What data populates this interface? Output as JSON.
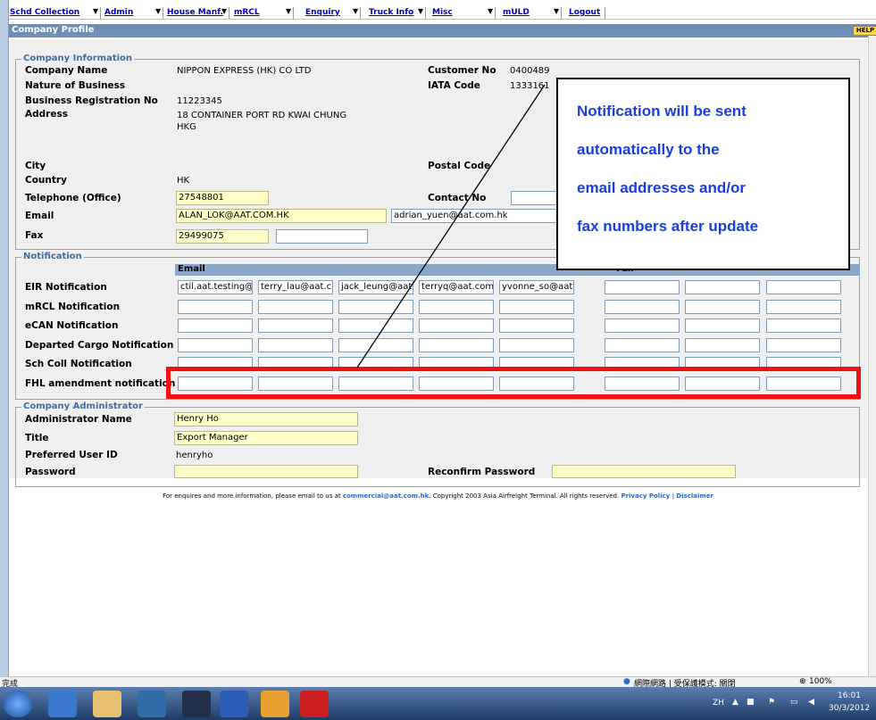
{
  "menu": {
    "items": [
      "Schd Collection",
      "Admin",
      "House Manf.",
      "mRCL",
      "Enquiry",
      "Truck Info",
      "Misc",
      "mULD",
      "Logout"
    ]
  },
  "page": {
    "title": "Company Profile",
    "help": "HELP"
  },
  "company_info": {
    "legend": "Company Information",
    "company_name_label": "Company Name",
    "company_name": "NIPPON EXPRESS (HK) CO LTD",
    "customer_no_label": "Customer No",
    "customer_no": "0400489",
    "nature_label": "Nature of Business",
    "iata_label": "IATA Code",
    "iata_code": "1333161",
    "brn_label": "Business Registration No",
    "brn": "11223345",
    "address_label": "Address",
    "address_line1": "18 CONTAINER PORT RD KWAI CHUNG",
    "address_line2": "HKG",
    "city_label": "City",
    "postal_label": "Postal Code",
    "country_label": "Country",
    "country": "HK",
    "telephone_label": "Telephone (Office)",
    "telephone": "27548801",
    "contact_label": "Contact No",
    "email_label": "Email",
    "email1": "ALAN_LOK@AAT.COM.HK",
    "email2": "adrian_yuen@aat.com.hk",
    "fax_label": "Fax",
    "fax": "29499075"
  },
  "notification": {
    "legend": "Notification",
    "email_header": "Email",
    "fax_header": "Fax",
    "rows": [
      {
        "label": "EIR Notification",
        "emails": [
          "ctil.aat.testing@",
          "terry_lau@aat.c",
          "jack_leung@aat",
          "terryq@aat.com",
          "yvonne_so@aat"
        ]
      },
      {
        "label": "mRCL Notification",
        "emails": [
          "",
          "",
          "",
          "",
          ""
        ]
      },
      {
        "label": "eCAN Notification",
        "emails": [
          "",
          "",
          "",
          "",
          ""
        ]
      },
      {
        "label": "Departed Cargo Notification",
        "emails": [
          "",
          "",
          "",
          "",
          ""
        ]
      },
      {
        "label": "Sch Coll Notification",
        "emails": [
          "",
          "",
          "",
          "",
          ""
        ]
      },
      {
        "label": "FHL amendment notification",
        "emails": [
          "",
          "",
          "",
          "",
          ""
        ]
      }
    ]
  },
  "admin": {
    "legend": "Company Administrator",
    "name_label": "Administrator Name",
    "name": "Henry Ho",
    "title_label": "Title",
    "title": "Export Manager",
    "userid_label": "Preferred User ID",
    "userid": "henryho",
    "password_label": "Password",
    "reconfirm_label": "Reconfirm Password"
  },
  "footer": {
    "text1": "For enquires and more information, please email to us at",
    "email": "commercial@aat.com.hk",
    "text2": ". Copyright 2003 Asia Airfreight Terminal. All rights reserved.",
    "privacy": "Privacy Policy",
    "sep": "|",
    "disclaimer": "Disclaimer"
  },
  "callout": {
    "lines": [
      "Notification will be sent",
      "automatically to the",
      "email addresses and/or",
      "fax numbers after update"
    ]
  },
  "status": {
    "left": "完成",
    "zone": "網際網路 | 受保護模式: 關閉",
    "zoom": "100%"
  },
  "tray": {
    "lang": "ZH",
    "time": "16:01",
    "date": "30/3/2012"
  },
  "colors": {
    "callout_text": "#1a3de0",
    "highlight": "#ee1111",
    "title_bar": "#6f8eb5",
    "legend": "#3b6ea5"
  }
}
